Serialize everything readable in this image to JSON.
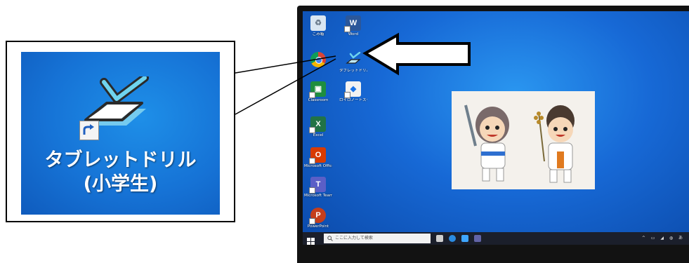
{
  "callout": {
    "icon_label": "タブレットドリル(小学生)",
    "icon_name": "tablet-drill-app-icon"
  },
  "desktop": {
    "icons": [
      {
        "name": "recycle-bin",
        "label": "ごみ箱",
        "color": "#d9e6f2",
        "glyph": "♻"
      },
      {
        "name": "word",
        "label": "Word",
        "color": "#2b579a",
        "glyph": "W"
      },
      {
        "name": "chrome",
        "label": "",
        "color": "#ffffff",
        "glyph": ""
      },
      {
        "name": "tablet-drill",
        "label": "タブレットドリル(小学生)",
        "color": "#1e7fe0",
        "glyph": ""
      },
      {
        "name": "classroom",
        "label": "Classroom",
        "color": "#1e8e3e",
        "glyph": "▣"
      },
      {
        "name": "school-app",
        "label": "ロイロノートスクール",
        "color": "#1a73e8",
        "glyph": "◆"
      },
      {
        "name": "excel",
        "label": "Excel",
        "color": "#217346",
        "glyph": "X"
      },
      {
        "name": "office",
        "label": "Microsoft Office Hub",
        "color": "#d83b01",
        "glyph": "O"
      },
      {
        "name": "teams",
        "label": "Microsoft Teams",
        "color": "#5b5fc7",
        "glyph": "T"
      },
      {
        "name": "powerpoint",
        "label": "PowerPoint",
        "color": "#c43e1c",
        "glyph": "P"
      }
    ],
    "taskbar": {
      "search_placeholder": "ここに入力して検索",
      "tray_text": "^ ▭ ◢ ◍ あ"
    }
  },
  "colors": {
    "desktop_blue": "#1769d6",
    "taskbar": "#1b1f2b",
    "arrow_fill": "#ffffff",
    "arrow_stroke": "#000000"
  }
}
